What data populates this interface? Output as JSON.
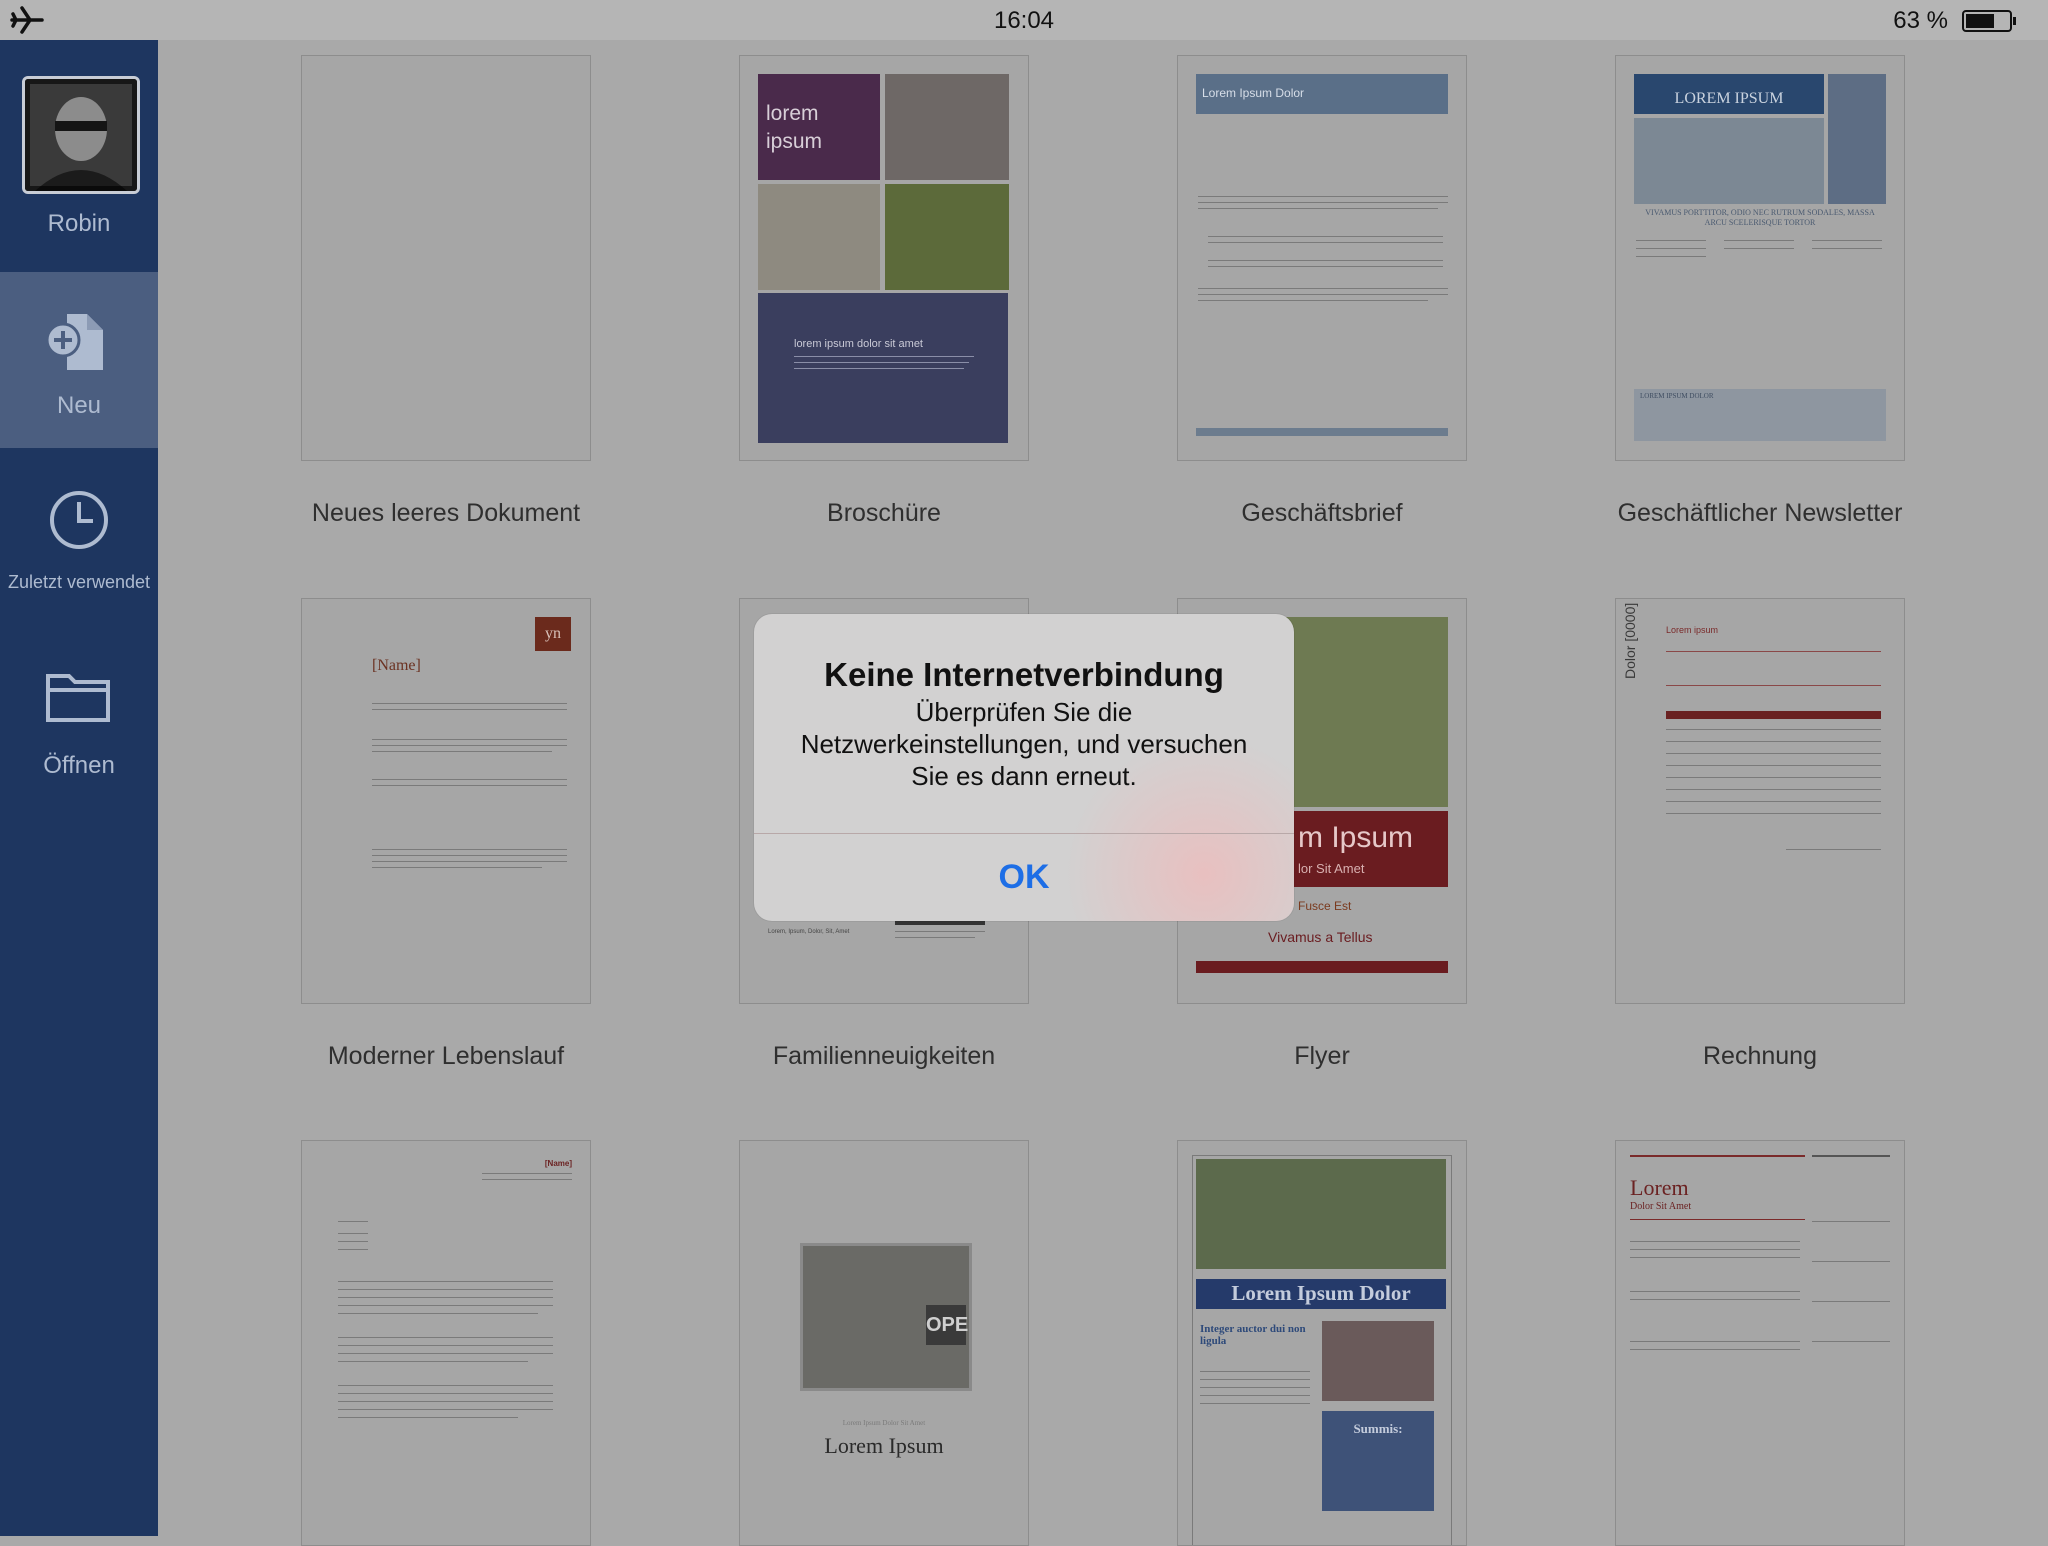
{
  "status_bar": {
    "time": "16:04",
    "battery": "63 %"
  },
  "sidebar": {
    "user": "Robin",
    "items": [
      {
        "label": "Neu"
      },
      {
        "label": "Zuletzt verwendet"
      },
      {
        "label": "Öffnen"
      }
    ]
  },
  "templates": [
    {
      "label": "Neues leeres Dokument"
    },
    {
      "label": "Broschüre",
      "preview_title": "lorem ipsum",
      "preview_text": "lorem ipsum dolor sit amet"
    },
    {
      "label": "Geschäftsbrief",
      "preview_header": "Lorem Ipsum Dolor"
    },
    {
      "label": "Geschäftlicher Newsletter",
      "preview_title": "LOREM IPSUM",
      "preview_sub": "VIVAMUS PORTTITOR, ODIO NEC RUTRUM SODALES, MASSA ARCU SCELERISQUE TORTOR",
      "preview_box": "LOREM IPSUM DOLOR"
    },
    {
      "label": "Moderner Lebenslauf",
      "preview_name": "[Name]",
      "preview_mark": "yn"
    },
    {
      "label": "Familienneuigkeiten",
      "preview_text": "Lorem, Ipsum, Dolor, Sit, Amet"
    },
    {
      "label": "Flyer",
      "preview_title": "m Ipsum",
      "preview_sub": "lor Sit Amet",
      "preview_line1": "Fusce Est",
      "preview_line2": "Vivamus a Tellus"
    },
    {
      "label": "Rechnung",
      "preview_vertical": "Dolor [0000]",
      "preview_title": "Lorem ipsum"
    },
    {
      "label": "",
      "preview_name": "[Name]"
    },
    {
      "label": "",
      "preview_small": "Lorem Ipsum Dolor Sit Amet",
      "preview_title": "Lorem Ipsum",
      "preview_sign": "OPE"
    },
    {
      "label": "",
      "preview_title": "Lorem Ipsum Dolor",
      "preview_sub": "Integer auctor dui non ligula",
      "preview_box": "Summis:"
    },
    {
      "label": "",
      "preview_title": "Lorem",
      "preview_sub": "Dolor Sit Amet"
    }
  ],
  "dialog": {
    "title": "Keine Internetverbindung",
    "message": "Überprüfen Sie die Netzwerkeinstellungen, und versuchen Sie es dann erneut.",
    "button": "OK"
  },
  "colors": {
    "sidebar": "#1e3660",
    "sidebar_selected": "#4b5e80",
    "dialog_button": "#1d6ee6"
  }
}
